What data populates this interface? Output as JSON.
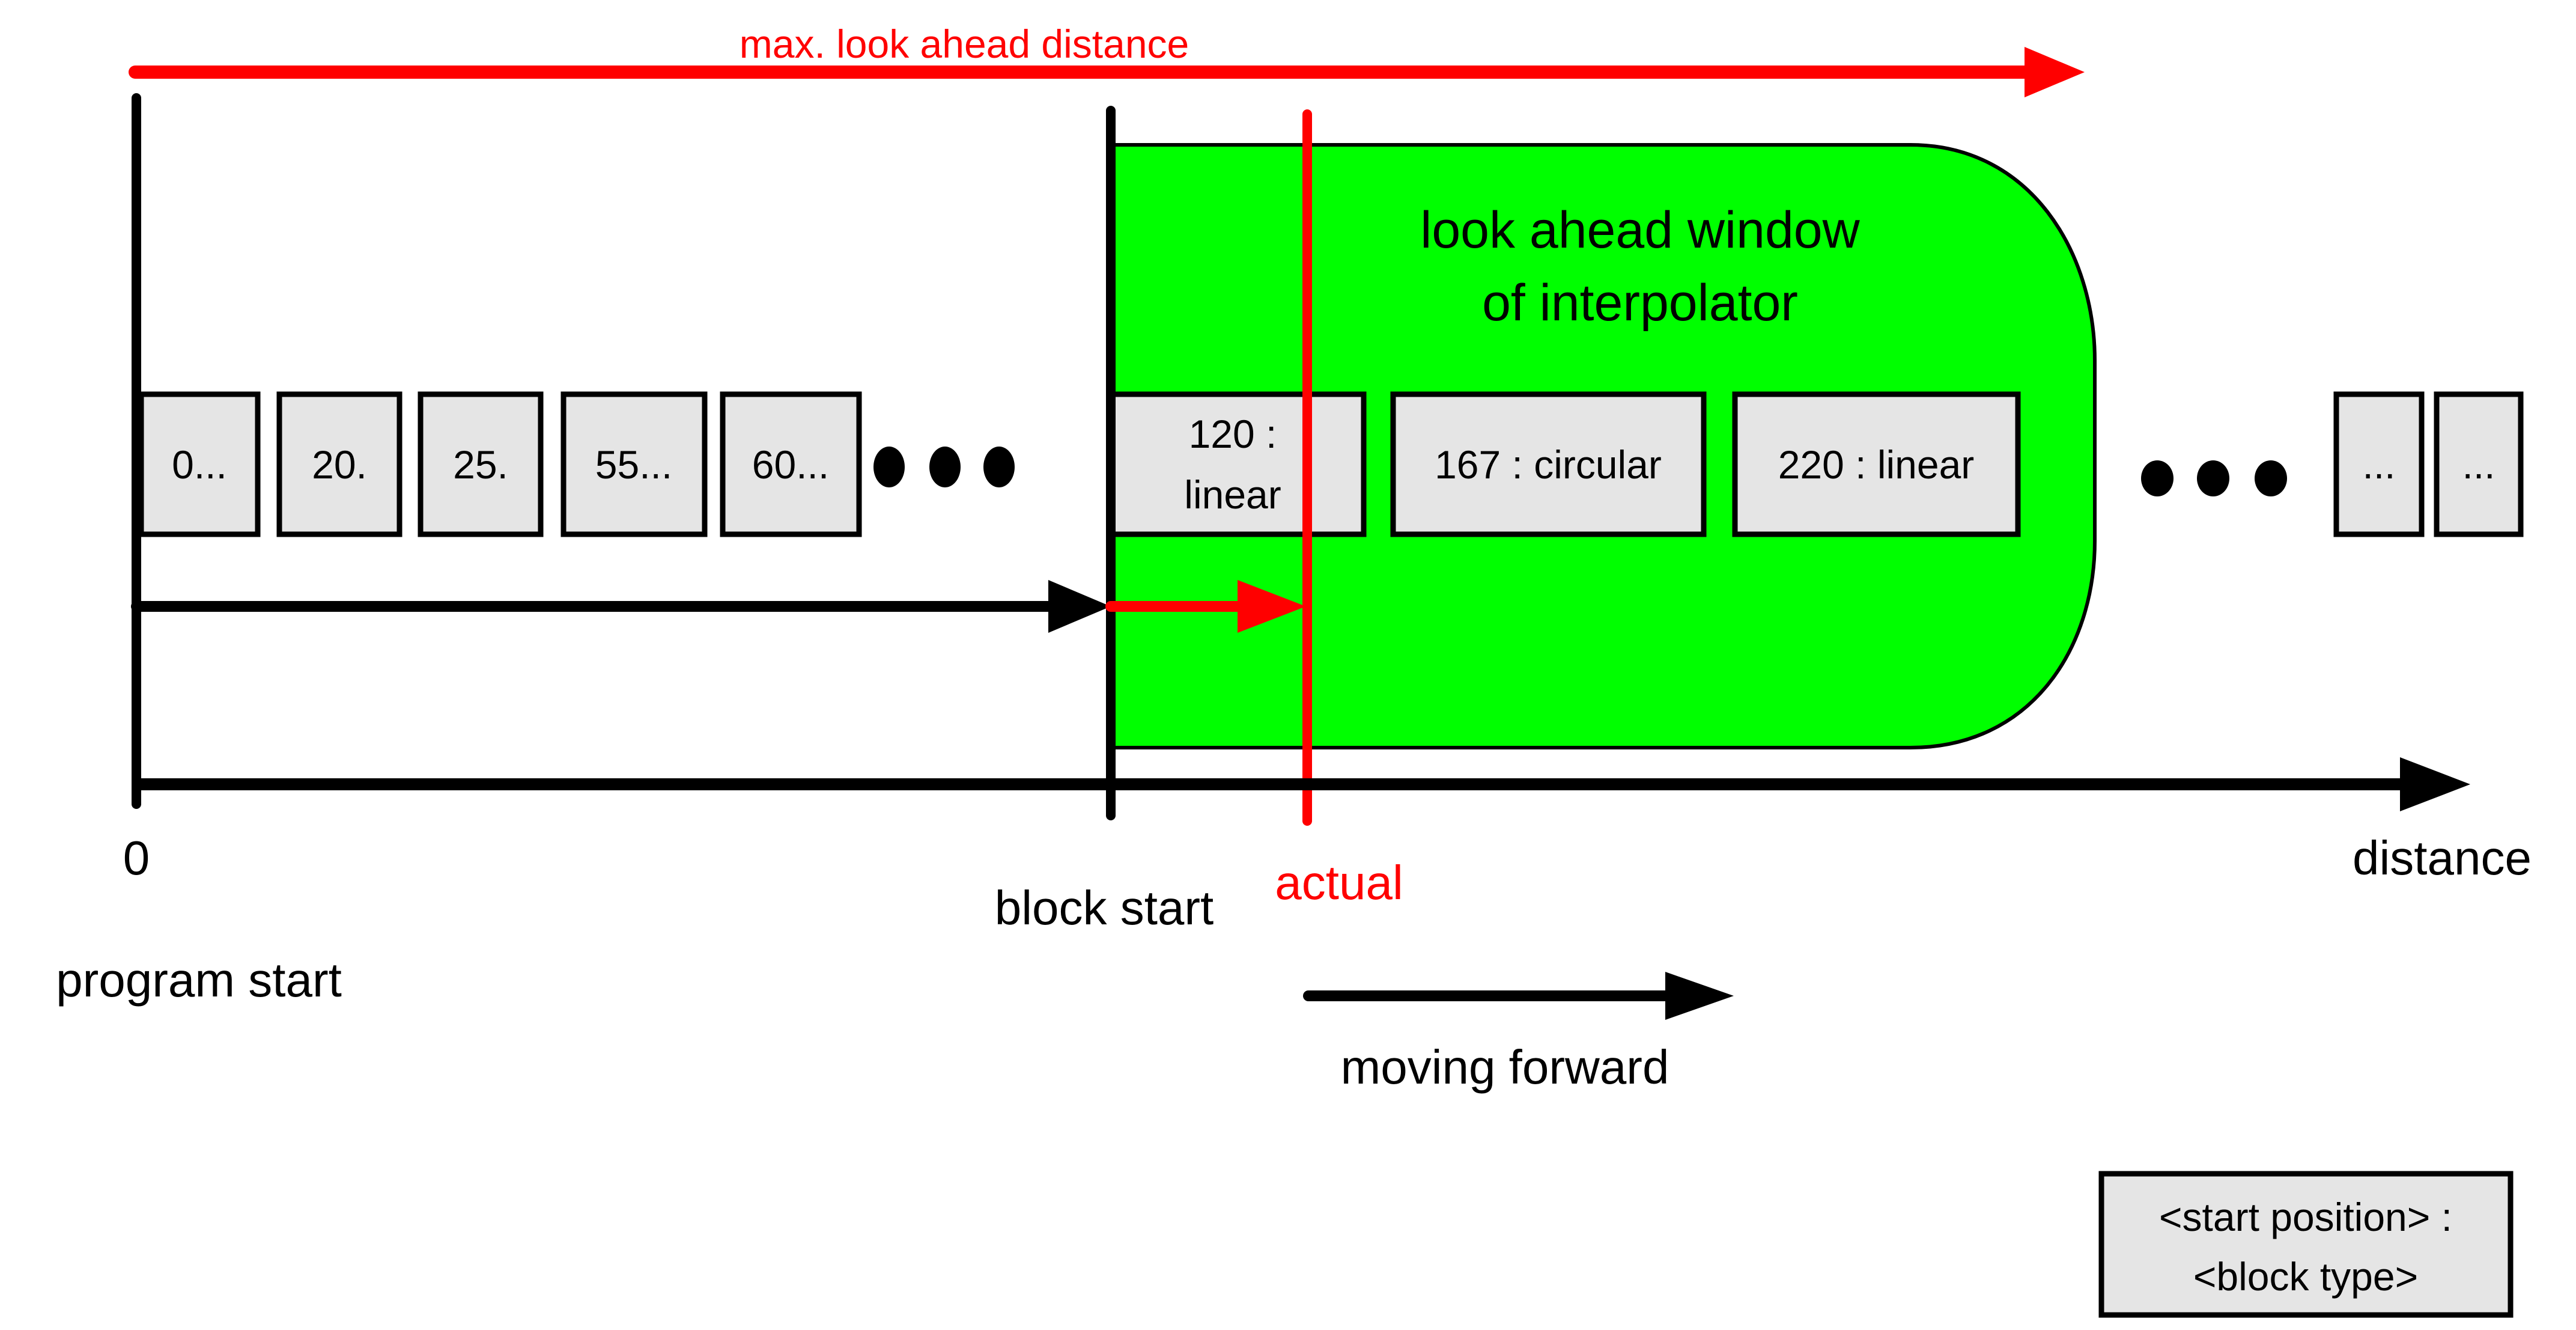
{
  "colors": {
    "window_fill": "#00ff00",
    "block_fill": "#e5e5e5",
    "accent_red": "#ff0000",
    "ink": "#000000"
  },
  "max_lookahead": {
    "label": "max. look ahead distance"
  },
  "window": {
    "title_line1": "look ahead window",
    "title_line2": "of interpolator"
  },
  "blocks_before": [
    "0...",
    "20.",
    "25.",
    "55...",
    "60..."
  ],
  "blocks_window": [
    {
      "line1": "120 :",
      "line2": "linear"
    },
    {
      "line1": "167 : circular"
    },
    {
      "line1": "220 : linear"
    }
  ],
  "blocks_after": [
    "...",
    "..."
  ],
  "ellipsis_dots": "●●●",
  "axis": {
    "origin_label": "0",
    "axis_label": "distance",
    "program_start_label": "program start",
    "block_start_label": "block start",
    "actual_label": "actual",
    "moving_forward_label": "moving forward"
  },
  "legend": {
    "line1": "<start position> :",
    "line2": "<block type>"
  }
}
